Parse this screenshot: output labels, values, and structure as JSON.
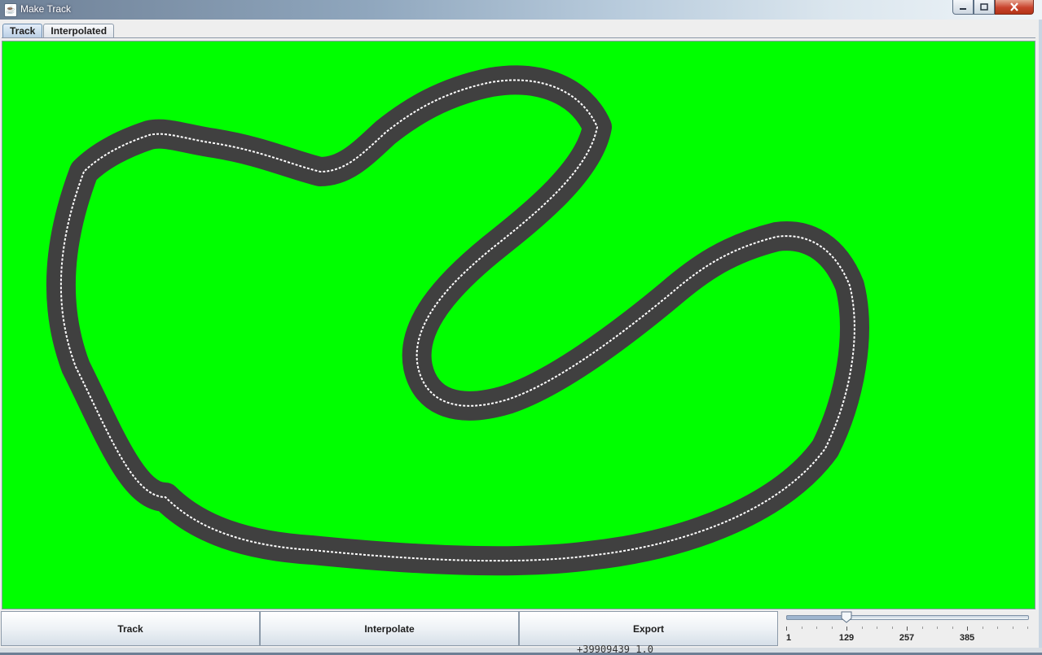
{
  "window": {
    "title": "Make Track",
    "app_icon": "java-cup-icon",
    "controls": {
      "minimize_icon": "minimize-icon",
      "maximize_icon": "maximize-icon",
      "close_icon": "close-icon"
    }
  },
  "tabs": [
    {
      "label": "Track",
      "active": true
    },
    {
      "label": "Interpolated",
      "active": false
    }
  ],
  "canvas": {
    "background_color": "#00ff00",
    "road_color": "#404040",
    "centerline_color": "#ffffff"
  },
  "buttons": {
    "track": "Track",
    "interpolate": "Interpolate",
    "export": "Export"
  },
  "slider": {
    "value": 129,
    "min": 1,
    "max": 513,
    "tick_labels": [
      "1",
      "129",
      "257",
      "385"
    ]
  },
  "background_text": "+39909439      1.0"
}
